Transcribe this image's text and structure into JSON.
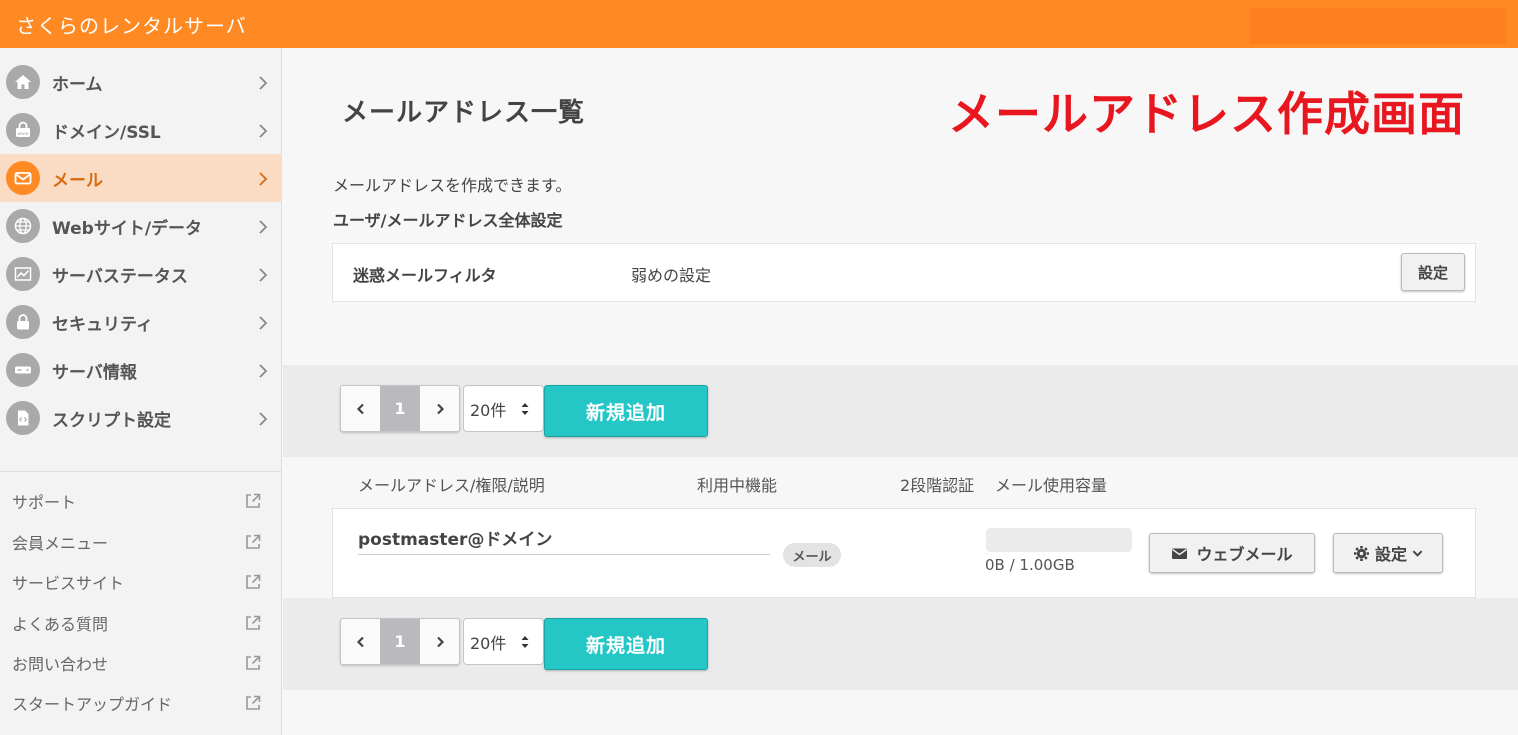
{
  "header": {
    "app_title": "さくらのレンタルサーバ"
  },
  "sidebar": {
    "items": [
      {
        "label": "ホーム",
        "icon": "home-icon",
        "active": false
      },
      {
        "label": "ドメイン/SSL",
        "icon": "lock-www-icon",
        "active": false
      },
      {
        "label": "メール",
        "icon": "mail-icon",
        "active": true
      },
      {
        "label": "Webサイト/データ",
        "icon": "globe-icon",
        "active": false
      },
      {
        "label": "サーバステータス",
        "icon": "chart-icon",
        "active": false
      },
      {
        "label": "セキュリティ",
        "icon": "padlock-icon",
        "active": false
      },
      {
        "label": "サーバ情報",
        "icon": "server-icon",
        "active": false
      },
      {
        "label": "スクリプト設定",
        "icon": "script-file-icon",
        "active": false
      }
    ],
    "links": [
      {
        "label": "サポート",
        "icon": "external-link-icon"
      },
      {
        "label": "会員メニュー",
        "icon": "external-link-icon"
      },
      {
        "label": "サービスサイト",
        "icon": "external-link-icon"
      },
      {
        "label": "よくある質問",
        "icon": "external-link-icon"
      },
      {
        "label": "お問い合わせ",
        "icon": "external-link-icon"
      },
      {
        "label": "スタートアップガイド",
        "icon": "external-link-icon"
      }
    ]
  },
  "main": {
    "page_title": "メールアドレス一覧",
    "overlay_title": "メールアドレス作成画面",
    "description": "メールアドレスを作成できます。",
    "section_title": "ユーザ/メールアドレス全体設定",
    "spam_filter": {
      "label": "迷惑メールフィルタ",
      "value": "弱めの設定",
      "button": "設定"
    },
    "pager": {
      "current_page": "1",
      "per_page": "20件",
      "new_button": "新規追加"
    },
    "columns": {
      "address": "メールアドレス/権限/説明",
      "features": "利用中機能",
      "two_factor": "2段階認証",
      "usage": "メール使用容量"
    },
    "rows": [
      {
        "address": "postmaster@ドメイン",
        "feature_badge": "メール",
        "usage_text": "0B / 1.00GB",
        "usage_fraction": 0,
        "webmail_button": "ウェブメール",
        "settings_button": "設定"
      }
    ]
  },
  "colors": {
    "brand": "#ff8a24",
    "accent": "#25c6c6",
    "overlay_red": "#e8161f",
    "active_bg": "#f9dcc3"
  }
}
